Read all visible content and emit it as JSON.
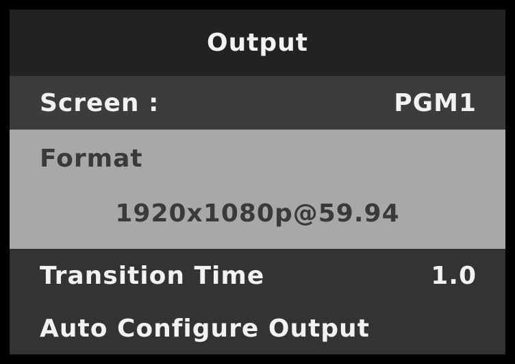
{
  "title": "Output",
  "screen": {
    "label": "Screen :",
    "value": "PGM1"
  },
  "format": {
    "label": "Format",
    "value": "1920x1080p@59.94"
  },
  "transition_time": {
    "label": "Transition Time",
    "value": "1.0"
  },
  "auto_configure": {
    "label": "Auto Configure Output"
  },
  "colors": {
    "panel_background": "#333333",
    "title_background": "#222222",
    "selected_row": "#a8a8a8",
    "text": "#f2f2f2",
    "selected_text": "#3a3a3a"
  }
}
